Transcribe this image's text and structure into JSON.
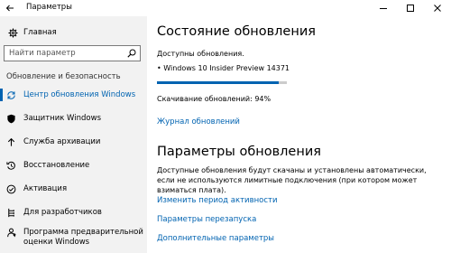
{
  "window": {
    "title": "Параметры"
  },
  "sidebar": {
    "home_label": "Главная",
    "search_placeholder": "Найти параметр",
    "section_label": "Обновление и безопасность",
    "items": [
      {
        "label": "Центр обновления Windows",
        "icon": "sync-icon",
        "active": true
      },
      {
        "label": "Защитник Windows",
        "icon": "shield-icon",
        "active": false
      },
      {
        "label": "Служба архивации",
        "icon": "backup-arrow-icon",
        "active": false
      },
      {
        "label": "Восстановление",
        "icon": "history-icon",
        "active": false
      },
      {
        "label": "Активация",
        "icon": "check-circle-icon",
        "active": false
      },
      {
        "label": "Для разработчиков",
        "icon": "developer-icon",
        "active": false
      },
      {
        "label": "Программа предварительной оценки Windows",
        "icon": "insider-icon",
        "active": false
      }
    ]
  },
  "main": {
    "status_title": "Состояние обновления",
    "available_text": "Доступны обновления.",
    "update_item": "• Windows 10 Insider Preview 14371",
    "progress_fraction": 0.94,
    "download_text": "Скачивание обновлений: 94%",
    "log_link": "Журнал обновлений",
    "settings_title": "Параметры обновления",
    "settings_desc": "Доступные обновления будут скачаны и установлены автоматически, если не используются лимитные подключения (при котором может взиматься плата).",
    "links": [
      "Изменить период активности",
      "Параметры перезапуска",
      "Дополнительные параметры"
    ]
  },
  "colors": {
    "accent": "#0063b1",
    "sidebar_bg": "#f2f2f2"
  }
}
